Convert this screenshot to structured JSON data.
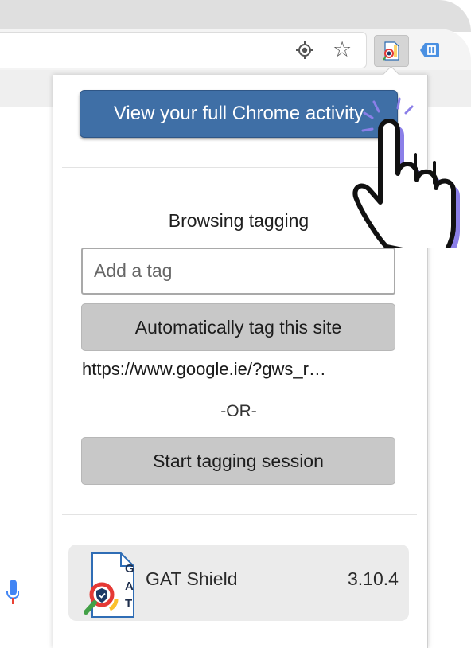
{
  "colors": {
    "primary_button": "#3f6fa6",
    "gray_button": "#c8c8c8",
    "footer_card": "#ebebeb",
    "hand_accent": "#8b7fe8"
  },
  "browser": {
    "toolbar_icons": [
      "location-target-icon",
      "star-icon",
      "gat-extension-icon",
      "extension-icon"
    ]
  },
  "popup": {
    "primary_button_label": "View your full Chrome activity",
    "section_heading": "Browsing tagging",
    "tag_input": {
      "placeholder": "Add a tag",
      "value": ""
    },
    "auto_tag_button_label": "Automatically tag this site",
    "current_url": "https://www.google.ie/?gws_r…",
    "or_separator": "-OR-",
    "session_button_label": "Start tagging session",
    "footer": {
      "logo_letters": [
        "G",
        "A",
        "T"
      ],
      "app_name": "GAT Shield",
      "version": "3.10.4"
    }
  }
}
